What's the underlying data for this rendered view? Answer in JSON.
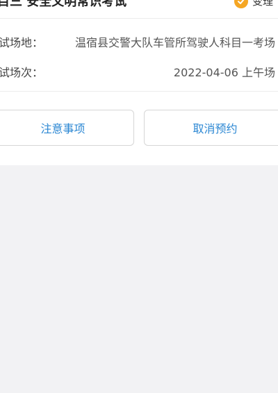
{
  "exam": {
    "title": "目三 安全文明常识考试",
    "status_label": "变理",
    "status_color": "#f5a623"
  },
  "info": {
    "venue_label": "试场地：",
    "venue_value": "温宿县交警大队车管所驾驶人科目一考场",
    "session_label": "试场次：",
    "session_value": "2022-04-06 上午场"
  },
  "actions": {
    "notice_label": "注意事项",
    "cancel_label": "取消预约"
  },
  "colors": {
    "accent": "#2b87d3",
    "background": "#f2f2f4"
  }
}
